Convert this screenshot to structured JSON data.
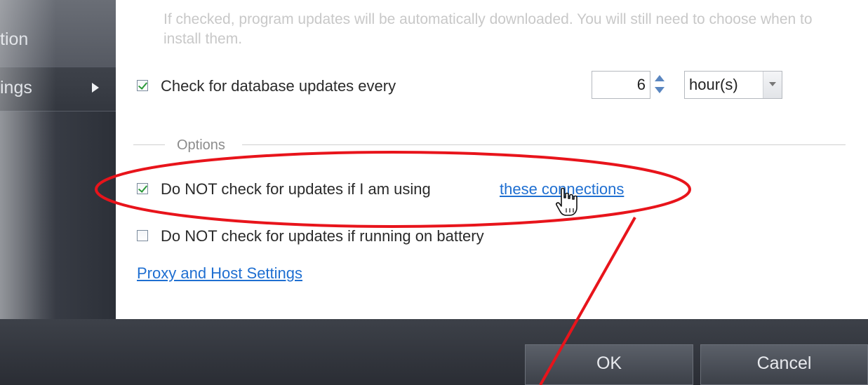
{
  "sidebar": {
    "items": [
      {
        "label": "tion"
      },
      {
        "label": "ings"
      }
    ]
  },
  "settings": {
    "description": "If checked, program updates will be automatically downloaded. You will still need to choose when to install them.",
    "db_updates": {
      "label": "Check for database updates every",
      "checked": true,
      "interval_value": "6",
      "interval_unit": "hour(s)"
    },
    "options_group_label": "Options",
    "no_check_connections": {
      "label": "Do NOT check for updates if I am using",
      "link": "these connections",
      "checked": true
    },
    "no_check_battery": {
      "label": "Do NOT check for updates if running on battery",
      "checked": false
    },
    "proxy_link": "Proxy and Host Settings"
  },
  "footer": {
    "ok_label": "OK",
    "cancel_label": "Cancel"
  },
  "colors": {
    "annotation": "#e8141b",
    "link": "#1f6fd1",
    "check": "#2c9a3a"
  },
  "icons": {
    "cursor": "hand-pointer-icon",
    "submenu_arrow": "arrow-right-icon"
  }
}
